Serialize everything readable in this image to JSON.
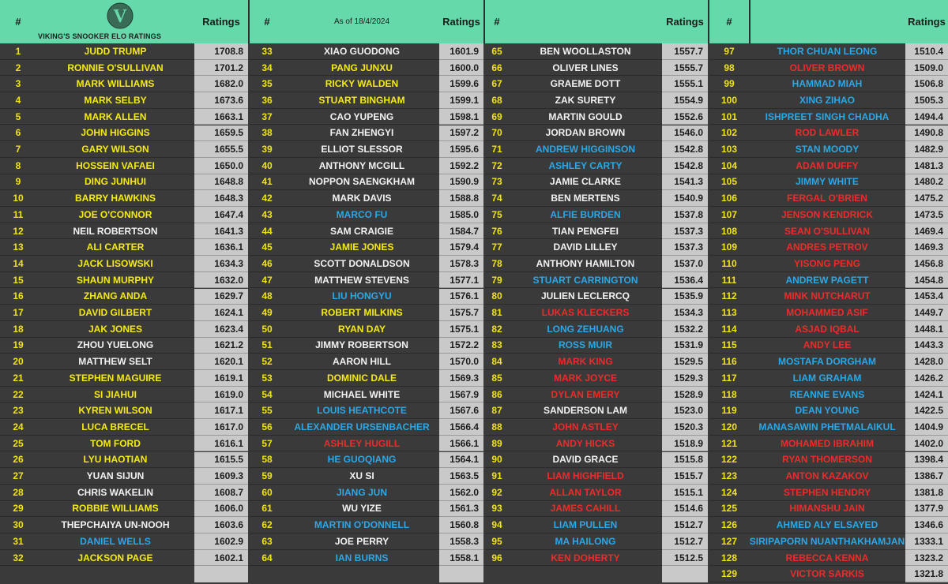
{
  "header": {
    "hash": "#",
    "ratings": "Ratings",
    "as_of": "As of 18/4/2024",
    "logo_letter": "V",
    "logo_caption": "VIKING'S SNOOKER ELO RATINGS"
  },
  "colors": {
    "yellow": "#f5eb10",
    "white": "#f2f2f2",
    "blue": "#2aa8e8",
    "red": "#ee2b2b",
    "header_green": "#66d9aa"
  },
  "columns": [
    [
      {
        "rank": "1",
        "name": "JUDD TRUMP",
        "rating": "1708.8",
        "color": "y"
      },
      {
        "rank": "2",
        "name": "RONNIE O'SULLIVAN",
        "rating": "1701.2",
        "color": "y"
      },
      {
        "rank": "3",
        "name": "MARK WILLIAMS",
        "rating": "1682.0",
        "color": "y"
      },
      {
        "rank": "4",
        "name": "MARK SELBY",
        "rating": "1673.6",
        "color": "y"
      },
      {
        "rank": "5",
        "name": "MARK ALLEN",
        "rating": "1663.1",
        "color": "y"
      },
      {
        "rank": "6",
        "name": "JOHN HIGGINS",
        "rating": "1659.5",
        "color": "y"
      },
      {
        "rank": "7",
        "name": "GARY WILSON",
        "rating": "1655.5",
        "color": "y"
      },
      {
        "rank": "8",
        "name": "HOSSEIN VAFAEI",
        "rating": "1650.0",
        "color": "y"
      },
      {
        "rank": "9",
        "name": "DING JUNHUI",
        "rating": "1648.8",
        "color": "y"
      },
      {
        "rank": "10",
        "name": "BARRY HAWKINS",
        "rating": "1648.3",
        "color": "y"
      },
      {
        "rank": "11",
        "name": "JOE O'CONNOR",
        "rating": "1647.4",
        "color": "y"
      },
      {
        "rank": "12",
        "name": "NEIL ROBERTSON",
        "rating": "1641.3",
        "color": "w"
      },
      {
        "rank": "13",
        "name": "ALI CARTER",
        "rating": "1636.1",
        "color": "y"
      },
      {
        "rank": "14",
        "name": "JACK LISOWSKI",
        "rating": "1634.3",
        "color": "y"
      },
      {
        "rank": "15",
        "name": "SHAUN MURPHY",
        "rating": "1632.0",
        "color": "y"
      },
      {
        "rank": "16",
        "name": "ZHANG ANDA",
        "rating": "1629.7",
        "color": "y"
      },
      {
        "rank": "17",
        "name": "DAVID GILBERT",
        "rating": "1624.1",
        "color": "y"
      },
      {
        "rank": "18",
        "name": "JAK JONES",
        "rating": "1623.4",
        "color": "y"
      },
      {
        "rank": "19",
        "name": "ZHOU YUELONG",
        "rating": "1621.2",
        "color": "w"
      },
      {
        "rank": "20",
        "name": "MATTHEW SELT",
        "rating": "1620.1",
        "color": "w"
      },
      {
        "rank": "21",
        "name": "STEPHEN MAGUIRE",
        "rating": "1619.1",
        "color": "y"
      },
      {
        "rank": "22",
        "name": "SI JIAHUI",
        "rating": "1619.0",
        "color": "y"
      },
      {
        "rank": "23",
        "name": "KYREN WILSON",
        "rating": "1617.1",
        "color": "y"
      },
      {
        "rank": "24",
        "name": "LUCA BRECEL",
        "rating": "1617.0",
        "color": "y"
      },
      {
        "rank": "25",
        "name": "TOM FORD",
        "rating": "1616.1",
        "color": "y"
      },
      {
        "rank": "26",
        "name": "LYU HAOTIAN",
        "rating": "1615.5",
        "color": "y"
      },
      {
        "rank": "27",
        "name": "YUAN SIJUN",
        "rating": "1609.3",
        "color": "w"
      },
      {
        "rank": "28",
        "name": "CHRIS WAKELIN",
        "rating": "1608.7",
        "color": "w"
      },
      {
        "rank": "29",
        "name": "ROBBIE WILLIAMS",
        "rating": "1606.0",
        "color": "y"
      },
      {
        "rank": "30",
        "name": "THEPCHAIYA UN-NOOH",
        "rating": "1603.6",
        "color": "w"
      },
      {
        "rank": "31",
        "name": "DANIEL WELLS",
        "rating": "1602.9",
        "color": "b"
      },
      {
        "rank": "32",
        "name": "JACKSON PAGE",
        "rating": "1602.1",
        "color": "y"
      }
    ],
    [
      {
        "rank": "33",
        "name": "XIAO GUODONG",
        "rating": "1601.9",
        "color": "w"
      },
      {
        "rank": "34",
        "name": "PANG JUNXU",
        "rating": "1600.0",
        "color": "y"
      },
      {
        "rank": "35",
        "name": "RICKY WALDEN",
        "rating": "1599.6",
        "color": "y"
      },
      {
        "rank": "36",
        "name": "STUART BINGHAM",
        "rating": "1599.1",
        "color": "y"
      },
      {
        "rank": "37",
        "name": "CAO YUPENG",
        "rating": "1598.1",
        "color": "w"
      },
      {
        "rank": "38",
        "name": "FAN ZHENGYI",
        "rating": "1597.2",
        "color": "w"
      },
      {
        "rank": "39",
        "name": "ELLIOT SLESSOR",
        "rating": "1595.6",
        "color": "w"
      },
      {
        "rank": "40",
        "name": "ANTHONY MCGILL",
        "rating": "1592.2",
        "color": "w"
      },
      {
        "rank": "41",
        "name": "NOPPON SAENGKHAM",
        "rating": "1590.9",
        "color": "w"
      },
      {
        "rank": "42",
        "name": "MARK DAVIS",
        "rating": "1588.8",
        "color": "w"
      },
      {
        "rank": "43",
        "name": "MARCO FU",
        "rating": "1585.0",
        "color": "b"
      },
      {
        "rank": "44",
        "name": "SAM CRAIGIE",
        "rating": "1584.7",
        "color": "w"
      },
      {
        "rank": "45",
        "name": "JAMIE JONES",
        "rating": "1579.4",
        "color": "y"
      },
      {
        "rank": "46",
        "name": "SCOTT DONALDSON",
        "rating": "1578.3",
        "color": "w"
      },
      {
        "rank": "47",
        "name": "MATTHEW STEVENS",
        "rating": "1577.1",
        "color": "w"
      },
      {
        "rank": "48",
        "name": "LIU HONGYU",
        "rating": "1576.1",
        "color": "b"
      },
      {
        "rank": "49",
        "name": "ROBERT MILKINS",
        "rating": "1575.7",
        "color": "y"
      },
      {
        "rank": "50",
        "name": "RYAN DAY",
        "rating": "1575.1",
        "color": "y"
      },
      {
        "rank": "51",
        "name": "JIMMY ROBERTSON",
        "rating": "1572.2",
        "color": "w"
      },
      {
        "rank": "52",
        "name": "AARON HILL",
        "rating": "1570.0",
        "color": "w"
      },
      {
        "rank": "53",
        "name": "DOMINIC DALE",
        "rating": "1569.3",
        "color": "y"
      },
      {
        "rank": "54",
        "name": "MICHAEL WHITE",
        "rating": "1567.9",
        "color": "w"
      },
      {
        "rank": "55",
        "name": "LOUIS HEATHCOTE",
        "rating": "1567.6",
        "color": "b"
      },
      {
        "rank": "56",
        "name": "ALEXANDER URSENBACHER",
        "rating": "1566.4",
        "color": "b"
      },
      {
        "rank": "57",
        "name": "ASHLEY HUGILL",
        "rating": "1566.1",
        "color": "r"
      },
      {
        "rank": "58",
        "name": "HE GUOQIANG",
        "rating": "1564.1",
        "color": "b"
      },
      {
        "rank": "59",
        "name": "XU SI",
        "rating": "1563.5",
        "color": "w"
      },
      {
        "rank": "60",
        "name": "JIANG JUN",
        "rating": "1562.0",
        "color": "b"
      },
      {
        "rank": "61",
        "name": "WU YIZE",
        "rating": "1561.3",
        "color": "w"
      },
      {
        "rank": "62",
        "name": "MARTIN O'DONNELL",
        "rating": "1560.8",
        "color": "b"
      },
      {
        "rank": "63",
        "name": "JOE PERRY",
        "rating": "1558.3",
        "color": "w"
      },
      {
        "rank": "64",
        "name": "IAN BURNS",
        "rating": "1558.1",
        "color": "b"
      }
    ],
    [
      {
        "rank": "65",
        "name": "BEN WOOLLASTON",
        "rating": "1557.7",
        "color": "w"
      },
      {
        "rank": "66",
        "name": "OLIVER LINES",
        "rating": "1555.7",
        "color": "w"
      },
      {
        "rank": "67",
        "name": "GRAEME DOTT",
        "rating": "1555.1",
        "color": "w"
      },
      {
        "rank": "68",
        "name": "ZAK SURETY",
        "rating": "1554.9",
        "color": "w"
      },
      {
        "rank": "69",
        "name": "MARTIN GOULD",
        "rating": "1552.6",
        "color": "w"
      },
      {
        "rank": "70",
        "name": "JORDAN BROWN",
        "rating": "1546.0",
        "color": "w"
      },
      {
        "rank": "71",
        "name": "ANDREW HIGGINSON",
        "rating": "1542.8",
        "color": "b"
      },
      {
        "rank": "72",
        "name": "ASHLEY CARTY",
        "rating": "1542.8",
        "color": "b"
      },
      {
        "rank": "73",
        "name": "JAMIE CLARKE",
        "rating": "1541.3",
        "color": "w"
      },
      {
        "rank": "74",
        "name": "BEN MERTENS",
        "rating": "1540.9",
        "color": "w"
      },
      {
        "rank": "75",
        "name": "ALFIE BURDEN",
        "rating": "1537.8",
        "color": "b"
      },
      {
        "rank": "76",
        "name": "TIAN PENGFEI",
        "rating": "1537.3",
        "color": "w"
      },
      {
        "rank": "77",
        "name": "DAVID LILLEY",
        "rating": "1537.3",
        "color": "w"
      },
      {
        "rank": "78",
        "name": "ANTHONY HAMILTON",
        "rating": "1537.0",
        "color": "w"
      },
      {
        "rank": "79",
        "name": "STUART CARRINGTON",
        "rating": "1536.4",
        "color": "b"
      },
      {
        "rank": "80",
        "name": "JULIEN LECLERCQ",
        "rating": "1535.9",
        "color": "w"
      },
      {
        "rank": "81",
        "name": "LUKAS KLECKERS",
        "rating": "1534.3",
        "color": "r"
      },
      {
        "rank": "82",
        "name": "LONG ZEHUANG",
        "rating": "1532.2",
        "color": "b"
      },
      {
        "rank": "83",
        "name": "ROSS MUIR",
        "rating": "1531.9",
        "color": "b"
      },
      {
        "rank": "84",
        "name": "MARK KING",
        "rating": "1529.5",
        "color": "r"
      },
      {
        "rank": "85",
        "name": "MARK JOYCE",
        "rating": "1529.3",
        "color": "r"
      },
      {
        "rank": "86",
        "name": "DYLAN EMERY",
        "rating": "1528.9",
        "color": "r"
      },
      {
        "rank": "87",
        "name": "SANDERSON LAM",
        "rating": "1523.0",
        "color": "w"
      },
      {
        "rank": "88",
        "name": "JOHN ASTLEY",
        "rating": "1520.3",
        "color": "r"
      },
      {
        "rank": "89",
        "name": "ANDY HICKS",
        "rating": "1518.9",
        "color": "r"
      },
      {
        "rank": "90",
        "name": "DAVID GRACE",
        "rating": "1515.8",
        "color": "w"
      },
      {
        "rank": "91",
        "name": "LIAM HIGHFIELD",
        "rating": "1515.7",
        "color": "r"
      },
      {
        "rank": "92",
        "name": "ALLAN TAYLOR",
        "rating": "1515.1",
        "color": "r"
      },
      {
        "rank": "93",
        "name": "JAMES CAHILL",
        "rating": "1514.6",
        "color": "r"
      },
      {
        "rank": "94",
        "name": "LIAM PULLEN",
        "rating": "1512.7",
        "color": "b"
      },
      {
        "rank": "95",
        "name": "MA HAILONG",
        "rating": "1512.7",
        "color": "b"
      },
      {
        "rank": "96",
        "name": "KEN DOHERTY",
        "rating": "1512.5",
        "color": "r"
      }
    ],
    [
      {
        "rank": "97",
        "name": "THOR CHUAN LEONG",
        "rating": "1510.4",
        "color": "b"
      },
      {
        "rank": "98",
        "name": "OLIVER BROWN",
        "rating": "1509.0",
        "color": "r"
      },
      {
        "rank": "99",
        "name": "HAMMAD MIAH",
        "rating": "1506.8",
        "color": "b"
      },
      {
        "rank": "100",
        "name": "XING ZIHAO",
        "rating": "1505.3",
        "color": "b"
      },
      {
        "rank": "101",
        "name": "ISHPREET SINGH CHADHA",
        "rating": "1494.4",
        "color": "b"
      },
      {
        "rank": "102",
        "name": "ROD LAWLER",
        "rating": "1490.8",
        "color": "r"
      },
      {
        "rank": "103",
        "name": "STAN MOODY",
        "rating": "1482.9",
        "color": "b"
      },
      {
        "rank": "104",
        "name": "ADAM DUFFY",
        "rating": "1481.3",
        "color": "r"
      },
      {
        "rank": "105",
        "name": "JIMMY WHITE",
        "rating": "1480.2",
        "color": "b"
      },
      {
        "rank": "106",
        "name": "FERGAL O'BRIEN",
        "rating": "1475.2",
        "color": "r"
      },
      {
        "rank": "107",
        "name": "JENSON KENDRICK",
        "rating": "1473.5",
        "color": "r"
      },
      {
        "rank": "108",
        "name": "SEAN O'SULLIVAN",
        "rating": "1469.4",
        "color": "r"
      },
      {
        "rank": "109",
        "name": "ANDRES PETROV",
        "rating": "1469.3",
        "color": "r"
      },
      {
        "rank": "110",
        "name": "YISONG PENG",
        "rating": "1456.8",
        "color": "r"
      },
      {
        "rank": "111",
        "name": "ANDREW PAGETT",
        "rating": "1454.8",
        "color": "b"
      },
      {
        "rank": "112",
        "name": "MINK NUTCHARUT",
        "rating": "1453.4",
        "color": "r"
      },
      {
        "rank": "113",
        "name": "MOHAMMED ASIF",
        "rating": "1449.7",
        "color": "r"
      },
      {
        "rank": "114",
        "name": "ASJAD IQBAL",
        "rating": "1448.1",
        "color": "r"
      },
      {
        "rank": "115",
        "name": "ANDY LEE",
        "rating": "1443.3",
        "color": "r"
      },
      {
        "rank": "116",
        "name": "MOSTAFA DORGHAM",
        "rating": "1428.0",
        "color": "b"
      },
      {
        "rank": "117",
        "name": "LIAM GRAHAM",
        "rating": "1426.2",
        "color": "b"
      },
      {
        "rank": "118",
        "name": "REANNE EVANS",
        "rating": "1424.1",
        "color": "b"
      },
      {
        "rank": "119",
        "name": "DEAN YOUNG",
        "rating": "1422.5",
        "color": "b"
      },
      {
        "rank": "120",
        "name": "MANASAWIN PHETMALAIKUL",
        "rating": "1404.9",
        "color": "b"
      },
      {
        "rank": "121",
        "name": "MOHAMED IBRAHIM",
        "rating": "1402.0",
        "color": "r"
      },
      {
        "rank": "122",
        "name": "RYAN THOMERSON",
        "rating": "1398.4",
        "color": "r"
      },
      {
        "rank": "123",
        "name": "ANTON KAZAKOV",
        "rating": "1386.7",
        "color": "r"
      },
      {
        "rank": "124",
        "name": "STEPHEN HENDRY",
        "rating": "1381.8",
        "color": "r"
      },
      {
        "rank": "125",
        "name": "HIMANSHU JAIN",
        "rating": "1377.9",
        "color": "r"
      },
      {
        "rank": "126",
        "name": "AHMED ALY ELSAYED",
        "rating": "1346.6",
        "color": "b"
      },
      {
        "rank": "127",
        "name": "SIRIPAPORN NUANTHAKHAMJAN",
        "rating": "1333.1",
        "color": "b"
      },
      {
        "rank": "128",
        "name": "REBECCA KENNA",
        "rating": "1323.2",
        "color": "r"
      },
      {
        "rank": "129",
        "name": "VICTOR SARKIS",
        "rating": "1321.8",
        "color": "r"
      }
    ]
  ]
}
